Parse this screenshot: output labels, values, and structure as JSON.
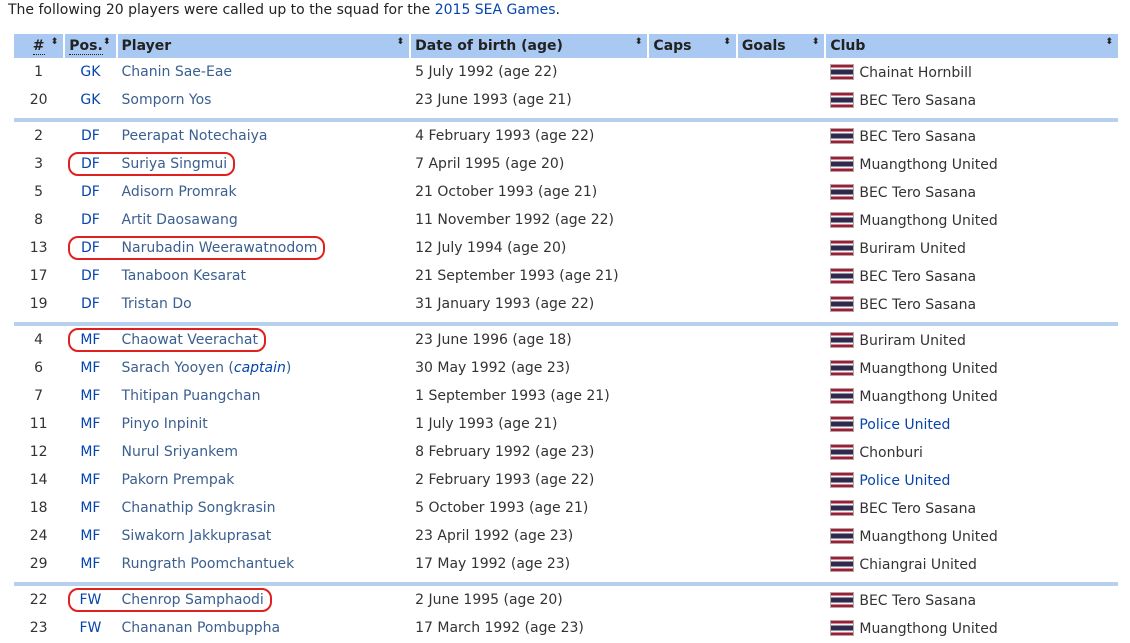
{
  "intro": {
    "text_before": "The following 20 players were called up to the squad for the ",
    "link": "2015 SEA Games",
    "text_after": "."
  },
  "headers": {
    "num": "#",
    "pos": "Pos.",
    "player": "Player",
    "dob": "Date of birth (age)",
    "caps": "Caps",
    "goals": "Goals",
    "club": "Club"
  },
  "groups": [
    [
      {
        "num": "1",
        "pos": "GK",
        "player": "Chanin Sae-Eae",
        "dob": "5 July 1992 (age 22)",
        "club": "Chainat Hornbill"
      },
      {
        "num": "20",
        "pos": "GK",
        "player": "Somporn Yos",
        "dob": "23 June 1993 (age 21)",
        "club": "BEC Tero Sasana"
      }
    ],
    [
      {
        "num": "2",
        "pos": "DF",
        "player": "Peerapat Notechaiya",
        "dob": "4 February 1993 (age 22)",
        "club": "BEC Tero Sasana"
      },
      {
        "num": "3",
        "pos": "DF",
        "player": "Suriya Singmui",
        "dob": "7 April 1995 (age 20)",
        "club": "Muangthong United",
        "circled": true
      },
      {
        "num": "5",
        "pos": "DF",
        "player": "Adisorn Promrak",
        "dob": "21 October 1993 (age 21)",
        "club": "BEC Tero Sasana"
      },
      {
        "num": "8",
        "pos": "DF",
        "player": "Artit Daosawang",
        "dob": "11 November 1992 (age 22)",
        "club": "Muangthong United"
      },
      {
        "num": "13",
        "pos": "DF",
        "player": "Narubadin Weerawatnodom",
        "dob": "12 July 1994 (age 20)",
        "club": "Buriram United",
        "circled": true
      },
      {
        "num": "17",
        "pos": "DF",
        "player": "Tanaboon Kesarat",
        "dob": "21 September 1993 (age 21)",
        "club": "BEC Tero Sasana"
      },
      {
        "num": "19",
        "pos": "DF",
        "player": "Tristan Do",
        "dob": "31 January 1993 (age 22)",
        "club": "BEC Tero Sasana"
      }
    ],
    [
      {
        "num": "4",
        "pos": "MF",
        "player": "Chaowat Veerachat",
        "dob": "23 June 1996 (age 18)",
        "club": "Buriram United",
        "circled": true
      },
      {
        "num": "6",
        "pos": "MF",
        "player": "Sarach Yooyen",
        "player_note": "captain",
        "dob": "30 May 1992 (age 23)",
        "club": "Muangthong United"
      },
      {
        "num": "7",
        "pos": "MF",
        "player": "Thitipan Puangchan",
        "dob": "1 September 1993 (age 21)",
        "club": "Muangthong United"
      },
      {
        "num": "11",
        "pos": "MF",
        "player": "Pinyo Inpinit",
        "dob": "1 July 1993 (age 21)",
        "club": "Police United",
        "club_link": true
      },
      {
        "num": "12",
        "pos": "MF",
        "player": "Nurul Sriyankem",
        "dob": "8 February 1992 (age 23)",
        "club": "Chonburi"
      },
      {
        "num": "14",
        "pos": "MF",
        "player": "Pakorn Prempak",
        "dob": "2 February 1993 (age 22)",
        "club": "Police United",
        "club_link": true
      },
      {
        "num": "18",
        "pos": "MF",
        "player": "Chanathip Songkrasin",
        "dob": "5 October 1993 (age 21)",
        "club": "BEC Tero Sasana"
      },
      {
        "num": "24",
        "pos": "MF",
        "player": "Siwakorn Jakkuprasat",
        "dob": "23 April 1992 (age 23)",
        "club": "Muangthong United"
      },
      {
        "num": "29",
        "pos": "MF",
        "player": "Rungrath Poomchantuek",
        "dob": "17 May 1992 (age 23)",
        "club": "Chiangrai United"
      }
    ],
    [
      {
        "num": "22",
        "pos": "FW",
        "player": "Chenrop Samphaodi",
        "dob": "2 June 1995 (age 20)",
        "club": "BEC Tero Sasana",
        "circled": true
      },
      {
        "num": "23",
        "pos": "FW",
        "player": "Chananan Pombuppha",
        "dob": "17 March 1992 (age 23)",
        "club": "Muangthong United"
      }
    ]
  ],
  "colors": {
    "header_bg": "#a9c8f2",
    "separator": "#b7d0ee",
    "link": "#0645ad",
    "highlight": "#e0201e"
  }
}
